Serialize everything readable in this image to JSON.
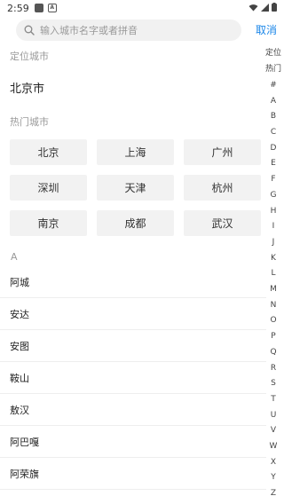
{
  "status_bar": {
    "time": "2:59"
  },
  "search": {
    "placeholder": "输入城市名字或者拼音",
    "cancel_label": "取消"
  },
  "located": {
    "title": "定位城市",
    "city": "北京市"
  },
  "hot": {
    "title": "热门城市",
    "cities": [
      "北京",
      "上海",
      "广州",
      "深圳",
      "天津",
      "杭州",
      "南京",
      "成都",
      "武汉"
    ]
  },
  "list": {
    "letter": "A",
    "cities": [
      "阿城",
      "安达",
      "安图",
      "鞍山",
      "敖汉",
      "阿巴嘎",
      "阿荣旗"
    ]
  },
  "index_bar": [
    "定位",
    "热门",
    "#",
    "A",
    "B",
    "C",
    "D",
    "E",
    "F",
    "G",
    "H",
    "I",
    "J",
    "K",
    "L",
    "M",
    "N",
    "O",
    "P",
    "Q",
    "R",
    "S",
    "T",
    "U",
    "V",
    "W",
    "X",
    "Y",
    "Z"
  ],
  "colors": {
    "accent": "#1a86e8",
    "muted": "#9a9a9a",
    "chip_bg": "#f2f2f2"
  }
}
